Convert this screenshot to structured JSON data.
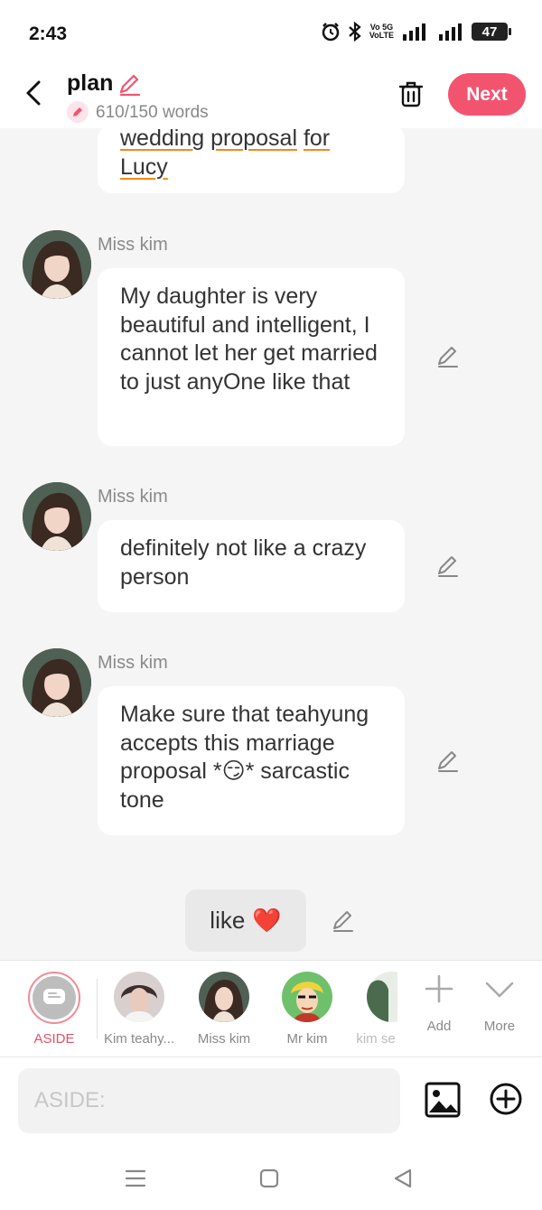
{
  "status": {
    "time": "2:43",
    "network": "5G",
    "volte": "Vo 5G\nVoLTE",
    "battery": "47"
  },
  "header": {
    "title": "plan",
    "word_count": "610/150 words",
    "next_label": "Next"
  },
  "chat": {
    "partial_message": {
      "line1": [
        "wedding",
        " ",
        "proposal",
        " ",
        "for"
      ],
      "line2": "Lucy"
    },
    "messages": [
      {
        "sender": "Miss kim",
        "text": "My daughter is very beautiful and intelligent, I cannot let her get married to just anyOne like that"
      },
      {
        "sender": "Miss kim",
        "text": "definitely not like a crazy person"
      },
      {
        "sender": "Miss kim",
        "text": "Make sure that teahyung accepts this marriage proposal *😏* sarcastic tone"
      }
    ],
    "my_message": {
      "text": "like",
      "emoji": "❤️"
    }
  },
  "characters": [
    {
      "name": "ASIDE",
      "active": true
    },
    {
      "name": "Kim teahy..."
    },
    {
      "name": "Miss kim"
    },
    {
      "name": "Mr kim"
    },
    {
      "name": "kim se"
    }
  ],
  "char_actions": {
    "add": "Add",
    "more": "More"
  },
  "composer": {
    "placeholder": "ASIDE:"
  },
  "colors": {
    "accent": "#f2546f",
    "underline": "#f08a1c"
  }
}
